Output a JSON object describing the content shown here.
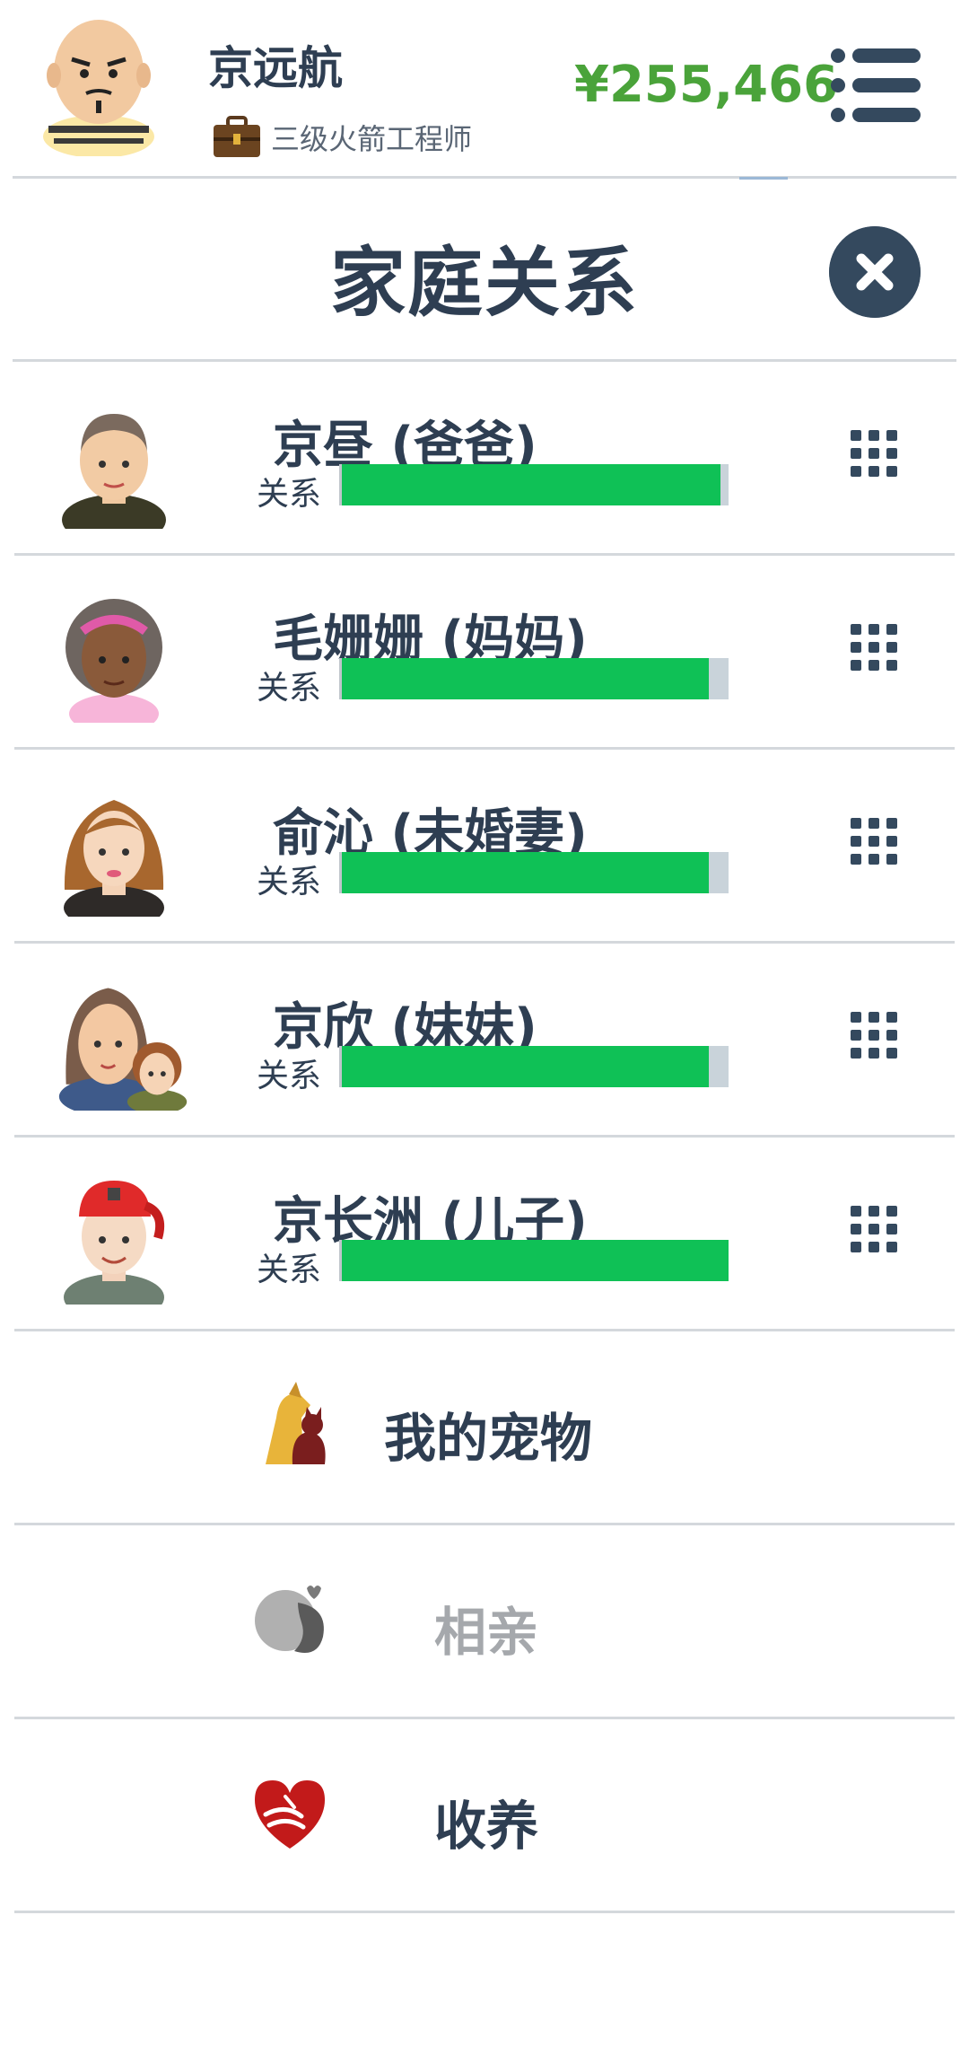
{
  "header": {
    "player_name": "京远航",
    "job_title": "三级火箭工程师",
    "money": "¥255,466"
  },
  "panel": {
    "title": "家庭关系"
  },
  "family": [
    {
      "name": "京昼 (爸爸)",
      "relation_label": "关系",
      "relation_level": 0.98
    },
    {
      "name": "毛姗姗 (妈妈)",
      "relation_label": "关系",
      "relation_level": 0.95
    },
    {
      "name": "俞沁 (未婚妻)",
      "relation_label": "关系",
      "relation_level": 0.95
    },
    {
      "name": "京欣 (妹妹)",
      "relation_label": "关系",
      "relation_level": 0.95
    },
    {
      "name": "京长洲 (儿子)",
      "relation_label": "关系",
      "relation_level": 1.0
    }
  ],
  "actions": [
    {
      "label": "我的宠物",
      "icon": "pet-icon",
      "color": "#2e3e52"
    },
    {
      "label": "相亲",
      "icon": "dating-icon",
      "color": "#a5a8ac"
    },
    {
      "label": "收养",
      "icon": "adoption-heart-icon",
      "color": "#2e3e52"
    }
  ],
  "colors": {
    "money": "#4aa33a",
    "relation_fill": "#0fc156",
    "relation_track": "#c9d3da",
    "text": "#2e3e52",
    "close_button": "#34495e"
  }
}
